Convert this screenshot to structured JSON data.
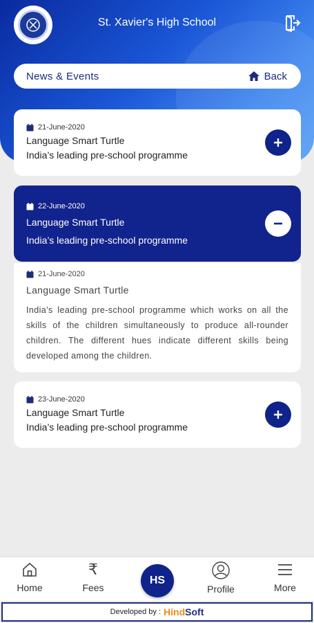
{
  "header": {
    "title": "St. Xavier's High School",
    "logo_icon": "school-crest-icon",
    "logout_icon": "logout-icon"
  },
  "section": {
    "title": "News & Events",
    "back_label": "Back",
    "back_icon": "home-icon"
  },
  "events": [
    {
      "date": "21-June-2020",
      "title": "Language Smart Turtle",
      "subtitle": "India’s leading pre-school programme",
      "expanded": false
    },
    {
      "date": "22-June-2020",
      "title": "Language Smart Turtle",
      "subtitle": "India’s leading pre-school programme",
      "expanded": true
    },
    {
      "date": "23-June-2020",
      "title": "Language Smart Turtle",
      "subtitle": "India’s leading pre-school programme",
      "expanded": false
    }
  ],
  "detail": {
    "date": "21-June-2020",
    "title": "Language Smart Turtle",
    "description": "India’s leading pre-school programme which works on all the skills of the children simultaneously to produce all-rounder children. The different hues indicate different skills being developed among the children."
  },
  "nav": {
    "home": "Home",
    "fees": "Fees",
    "center": "HS",
    "profile": "Profile",
    "more": "More"
  },
  "footer": {
    "developed_by": "Developed by :",
    "brand_h": "Hind",
    "brand_s": "Soft"
  },
  "colors": {
    "primary": "#0f238a",
    "header_gradient_start": "#0a2aa0",
    "header_gradient_end": "#5aa0f5",
    "background": "#ececec",
    "brand_orange": "#f08a1e"
  }
}
